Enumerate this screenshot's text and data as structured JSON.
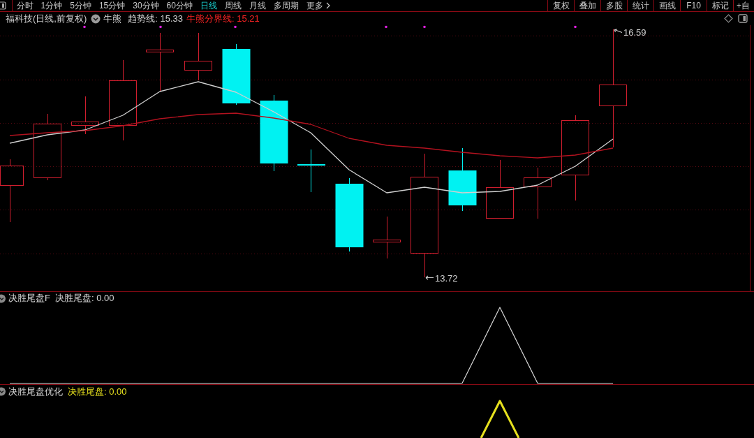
{
  "toolbar": {
    "periods": [
      {
        "label": "分时",
        "selected": false,
        "kind": "period"
      },
      {
        "label": "1分钟",
        "selected": false,
        "kind": "period"
      },
      {
        "label": "5分钟",
        "selected": false,
        "kind": "period"
      },
      {
        "label": "15分钟",
        "selected": false,
        "kind": "period"
      },
      {
        "label": "30分钟",
        "selected": false,
        "kind": "period"
      },
      {
        "label": "60分钟",
        "selected": false,
        "kind": "period"
      },
      {
        "label": "日线",
        "selected": true,
        "kind": "period"
      },
      {
        "label": "周线",
        "selected": false,
        "kind": "period"
      },
      {
        "label": "月线",
        "selected": false,
        "kind": "period"
      },
      {
        "label": "多周期",
        "selected": false,
        "kind": "period"
      },
      {
        "label": "更多",
        "selected": false,
        "kind": "menu"
      }
    ],
    "tools": [
      "复权",
      "叠加",
      "多股",
      "统计",
      "画线",
      "F10",
      "标记",
      "+自"
    ]
  },
  "main_chart": {
    "title": "福科技(日线,前复权)",
    "indicator": "牛熊",
    "lines": [
      {
        "text": "趋势线: 15.33",
        "kind": "trend",
        "color": "#d8d8d8"
      },
      {
        "text": "牛熊分界线: 15.21",
        "kind": "boundary",
        "color": "#ff2424"
      }
    ],
    "high_label": "16.59",
    "low_label": "13.72"
  },
  "sub_panels": [
    {
      "title": "决胜尾盘F",
      "lines": [
        {
          "text": "决胜尾盘: 0.00",
          "color": "#d8d8d8"
        }
      ]
    },
    {
      "title": "决胜尾盘优化",
      "lines": [
        {
          "text": "决胜尾盘: 0.00",
          "color": "#e6e01e"
        }
      ]
    }
  ]
}
